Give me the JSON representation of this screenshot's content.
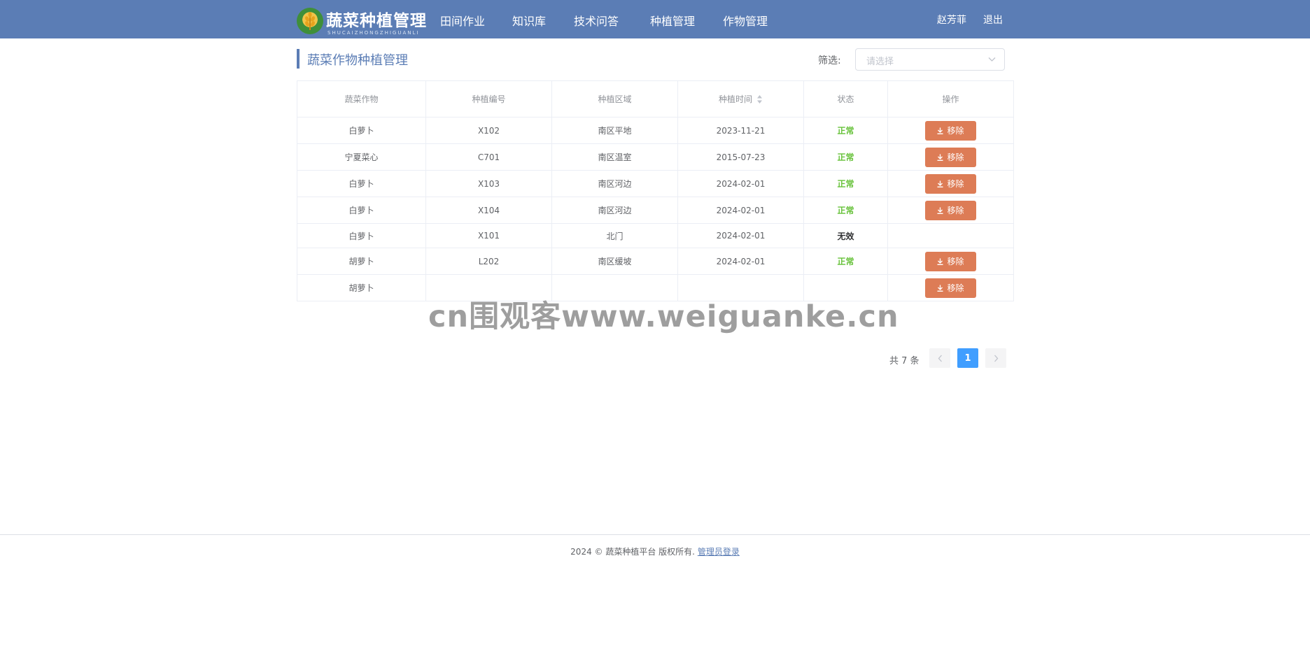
{
  "brand": {
    "title": "蔬菜种植管理",
    "subtitle": "SHUCAIZHONGZHIGUANLI"
  },
  "nav": {
    "items": [
      "田间作业",
      "知识库",
      "技术问答",
      "种植管理",
      "作物管理"
    ]
  },
  "user": {
    "name": "赵芳菲",
    "logout": "退出"
  },
  "page": {
    "title": "蔬菜作物种植管理",
    "filter_label": "筛选:",
    "filter_placeholder": "请选择"
  },
  "table": {
    "columns": [
      "蔬菜作物",
      "种植编号",
      "种植区域",
      "种植时间",
      "状态",
      "操作"
    ],
    "rows": [
      {
        "crop": "白萝卜",
        "code": "X102",
        "area": "南区平地",
        "date": "2023-11-21",
        "status": "正常",
        "action": "移除"
      },
      {
        "crop": "宁夏菜心",
        "code": "C701",
        "area": "南区温室",
        "date": "2015-07-23",
        "status": "正常",
        "action": "移除"
      },
      {
        "crop": "白萝卜",
        "code": "X103",
        "area": "南区河边",
        "date": "2024-02-01",
        "status": "正常",
        "action": "移除"
      },
      {
        "crop": "白萝卜",
        "code": "X104",
        "area": "南区河边",
        "date": "2024-02-01",
        "status": "正常",
        "action": "移除"
      },
      {
        "crop": "白萝卜",
        "code": "X101",
        "area": "北门",
        "date": "2024-02-01",
        "status": "无效",
        "action": ""
      },
      {
        "crop": "胡萝卜",
        "code": "L202",
        "area": "南区缓坡",
        "date": "2024-02-01",
        "status": "正常",
        "action": "移除"
      },
      {
        "crop": "胡萝卜",
        "code": "",
        "area": "",
        "date": "",
        "status": "",
        "action": "移除"
      }
    ]
  },
  "pagination": {
    "total": "共 7 条",
    "current": "1"
  },
  "watermark": "cn围观客www.weiguanke.cn",
  "footer": {
    "text": "2024 © 蔬菜种植平台 版权所有.",
    "link": "管理员登录"
  },
  "colors": {
    "header_bg": "#5b7db5",
    "status_ok": "#67c23a",
    "status_invalid": "#303133",
    "remove_button": "#dd7c56",
    "page_active": "#409eff"
  },
  "icons": {
    "logo": "wheat-logo-icon",
    "sort": "sort-caret-icon",
    "chevron": "chevron-down-icon",
    "remove": "download-icon",
    "prev": "chevron-left-icon",
    "next": "chevron-right-icon"
  }
}
